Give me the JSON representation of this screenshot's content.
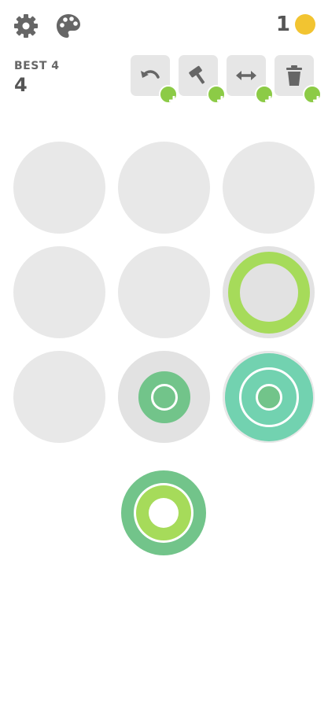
{
  "header": {
    "coins": "1",
    "best_label": "BEST 4",
    "score": "4"
  },
  "icons": {
    "settings": "gear-icon",
    "theme": "palette-icon",
    "coin": "coin-icon",
    "undo": "undo-icon",
    "hammer": "hammer-icon",
    "swap": "swap-icon",
    "trash": "trash-icon",
    "plus": "plus-icon"
  },
  "tools": [
    "undo",
    "hammer",
    "swap",
    "trash"
  ],
  "colors": {
    "cell_empty": "#e8e8e8",
    "ring_small": "#72c48a",
    "ring_medium": "#72d2b0",
    "ring_large": "#a6db5a",
    "coin": "#f2c431",
    "plus_badge": "#8ccb46",
    "icon_gray": "#666666"
  },
  "board": [
    [
      [],
      [],
      []
    ],
    [
      [],
      [],
      [
        "large"
      ]
    ],
    [
      [],
      [
        "small"
      ],
      [
        "large",
        "medium",
        "small"
      ]
    ]
  ],
  "next_piece": [
    "small",
    "medium",
    "large"
  ]
}
